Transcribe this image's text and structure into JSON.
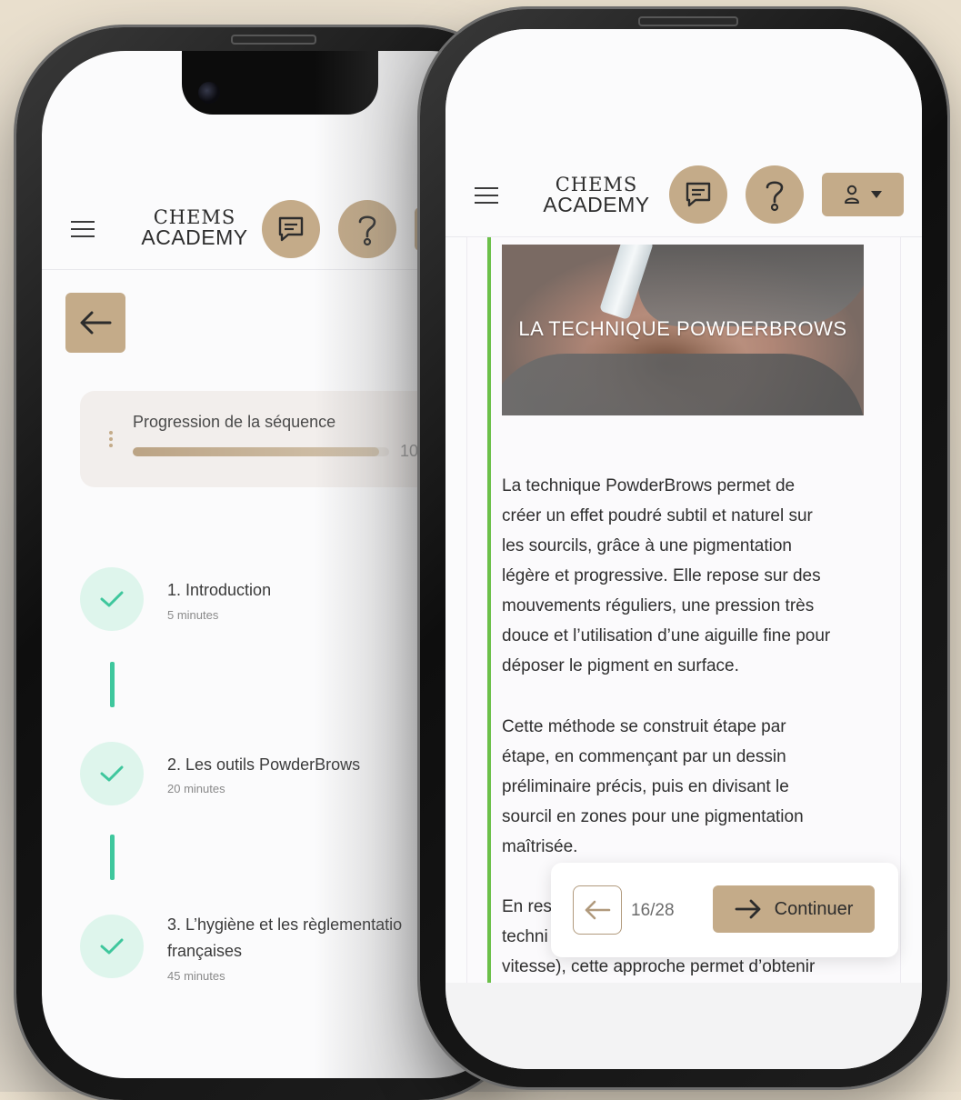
{
  "brand": {
    "line1": "CHEMS",
    "line2": "ACADEMY"
  },
  "left_screen": {
    "progress": {
      "title": "Progression de la séquence",
      "value_text": "10",
      "fill_fraction": 0.96
    },
    "steps": [
      {
        "title": "1. Introduction",
        "duration": "5 minutes"
      },
      {
        "title": "2. Les outils PowderBrows",
        "duration": "20 minutes"
      },
      {
        "title_line1": "3. L’hygiène et les règlementatio",
        "title_line2": "françaises",
        "duration": "45 minutes"
      }
    ]
  },
  "right_screen": {
    "image_caption": "LA TECHNIQUE POWDERBROWS",
    "paragraphs": [
      [
        "La technique PowderBrows  permet de",
        "créer un effet poudré subtil et naturel sur",
        "les sourcils, grâce à une pigmentation",
        "légère et progressive. Elle repose sur des",
        "mouvements réguliers, une pression très",
        "douce et l’utilisation d’une aiguille fine pour",
        "déposer le pigment en surface."
      ],
      [
        "Cette méthode se construit étape par",
        "étape, en commençant par un dessin",
        "préliminaire précis, puis en divisant le",
        "sourcil en zones pour une pigmentation",
        "maîtrisée."
      ],
      [
        "En res",
        "techni",
        "vitesse), cette approche permet d’obtenir"
      ]
    ],
    "nav": {
      "page_counter": "16/28",
      "continue_label": "Continuer"
    }
  },
  "colors": {
    "accent": "#c4ab89",
    "success": "#3fc79d",
    "content_bar": "#6cc04a"
  }
}
